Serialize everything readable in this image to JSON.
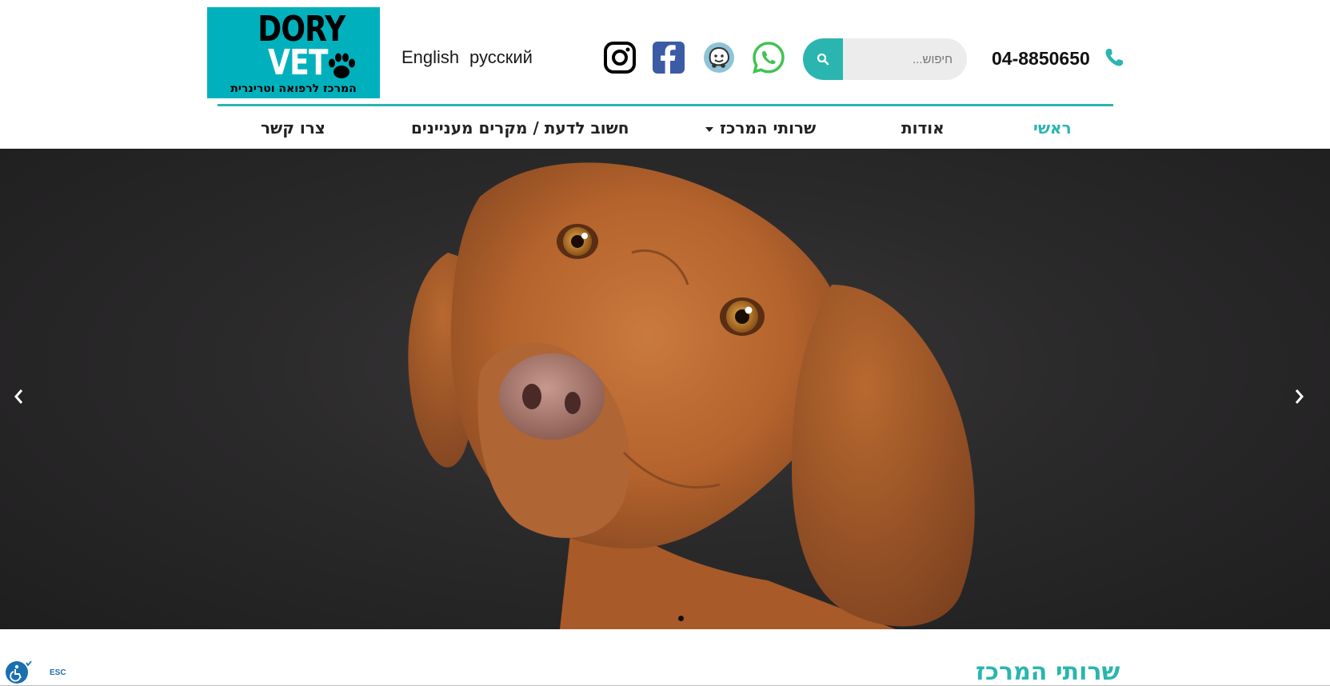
{
  "logo": {
    "title_top": "DORY",
    "title_bottom": "VET",
    "subtitle": "המרכז לרפואה וטרינרית"
  },
  "languages": [
    "English",
    "русский"
  ],
  "social": [
    "instagram-icon",
    "facebook-icon",
    "waze-icon",
    "whatsapp-icon"
  ],
  "search": {
    "placeholder": "חיפוש..."
  },
  "phone": "04-8850650",
  "nav": {
    "home": "ראשי",
    "about": "אודות",
    "services": "שרותי המרכז",
    "important": "חשוב לדעת / מקרים מעניינים",
    "contact": "צרו קשר"
  },
  "section_title": "שרותי המרכז",
  "accessibility": {
    "esc": "ESC"
  },
  "colors": {
    "accent": "#2bb5b0",
    "logo_bg": "#00b1bd",
    "hero_bg": "#2b2a2b"
  }
}
